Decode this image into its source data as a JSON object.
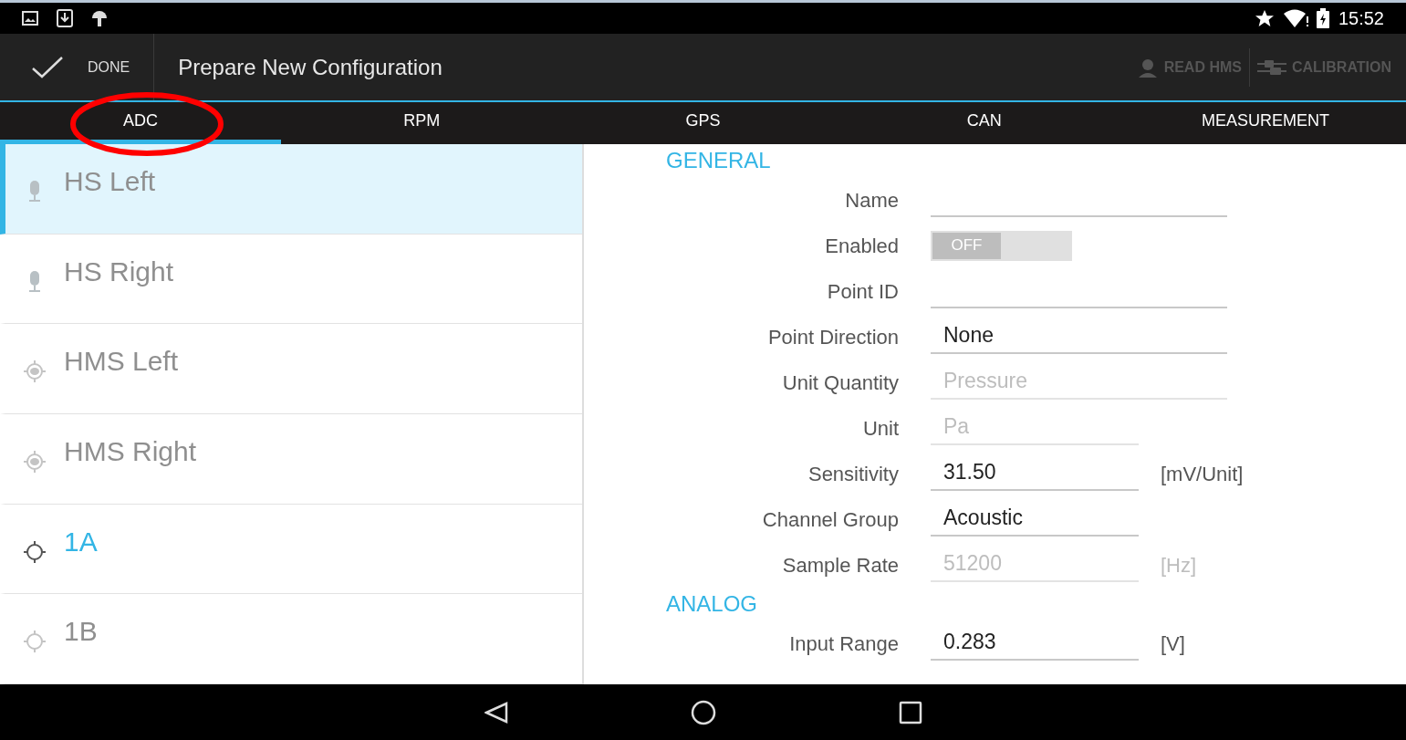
{
  "status_bar": {
    "time": "15:52"
  },
  "action_bar": {
    "done": "DONE",
    "title": "Prepare New Configuration",
    "actions": [
      {
        "kind": "person",
        "label": "READ HMS",
        "disabled": true
      },
      {
        "kind": "calibration",
        "label": "CALIBRATION",
        "disabled": true
      }
    ]
  },
  "tabs": [
    {
      "label": "ADC",
      "selected": true
    },
    {
      "label": "RPM",
      "selected": false
    },
    {
      "label": "GPS",
      "selected": false
    },
    {
      "label": "CAN",
      "selected": false
    },
    {
      "label": "MEASUREMENT",
      "selected": false
    }
  ],
  "annotation": {
    "kind": "ellipse",
    "color": "#ff0000"
  },
  "channels": [
    {
      "name": "HS Left",
      "kind": "mic",
      "selected": true,
      "highlighted": false
    },
    {
      "name": "HS Right",
      "kind": "mic",
      "selected": false,
      "highlighted": false
    },
    {
      "name": "HMS Left",
      "kind": "hms",
      "selected": false,
      "highlighted": false
    },
    {
      "name": "HMS Right",
      "kind": "hms",
      "selected": false,
      "highlighted": false
    },
    {
      "name": "1A",
      "kind": "point",
      "selected": false,
      "highlighted": true
    },
    {
      "name": "1B",
      "kind": "point",
      "selected": false,
      "highlighted": false
    }
  ],
  "sections": [
    {
      "title": "GENERAL",
      "fields": [
        {
          "kind": "text",
          "label": "Name",
          "wide": true,
          "disabled": false
        },
        {
          "kind": "toggle",
          "label": "Enabled",
          "on": false,
          "state_text": "OFF"
        },
        {
          "kind": "text",
          "label": "Point ID",
          "wide": true,
          "disabled": false
        },
        {
          "kind": "text",
          "label": "Point Direction",
          "value": "None",
          "wide": true,
          "disabled": false
        },
        {
          "kind": "text",
          "label": "Unit Quantity",
          "value": "Pressure",
          "wide": true,
          "disabled": true
        },
        {
          "kind": "text",
          "label": "Unit",
          "value": "Pa",
          "wide": false,
          "disabled": true
        },
        {
          "kind": "text",
          "label": "Sensitivity",
          "value": "31.50",
          "unit": "[mV/Unit]",
          "wide": false,
          "disabled": false
        },
        {
          "kind": "text",
          "label": "Channel Group",
          "value": "Acoustic",
          "wide": false,
          "disabled": false
        },
        {
          "kind": "text",
          "label": "Sample Rate",
          "value": "51200",
          "unit": "[Hz]",
          "wide": false,
          "disabled": true
        }
      ]
    },
    {
      "title": "ANALOG",
      "fields": [
        {
          "kind": "text",
          "label": "Input Range",
          "value": "0.283",
          "unit": "[V]",
          "wide": false,
          "disabled": false
        }
      ]
    }
  ]
}
